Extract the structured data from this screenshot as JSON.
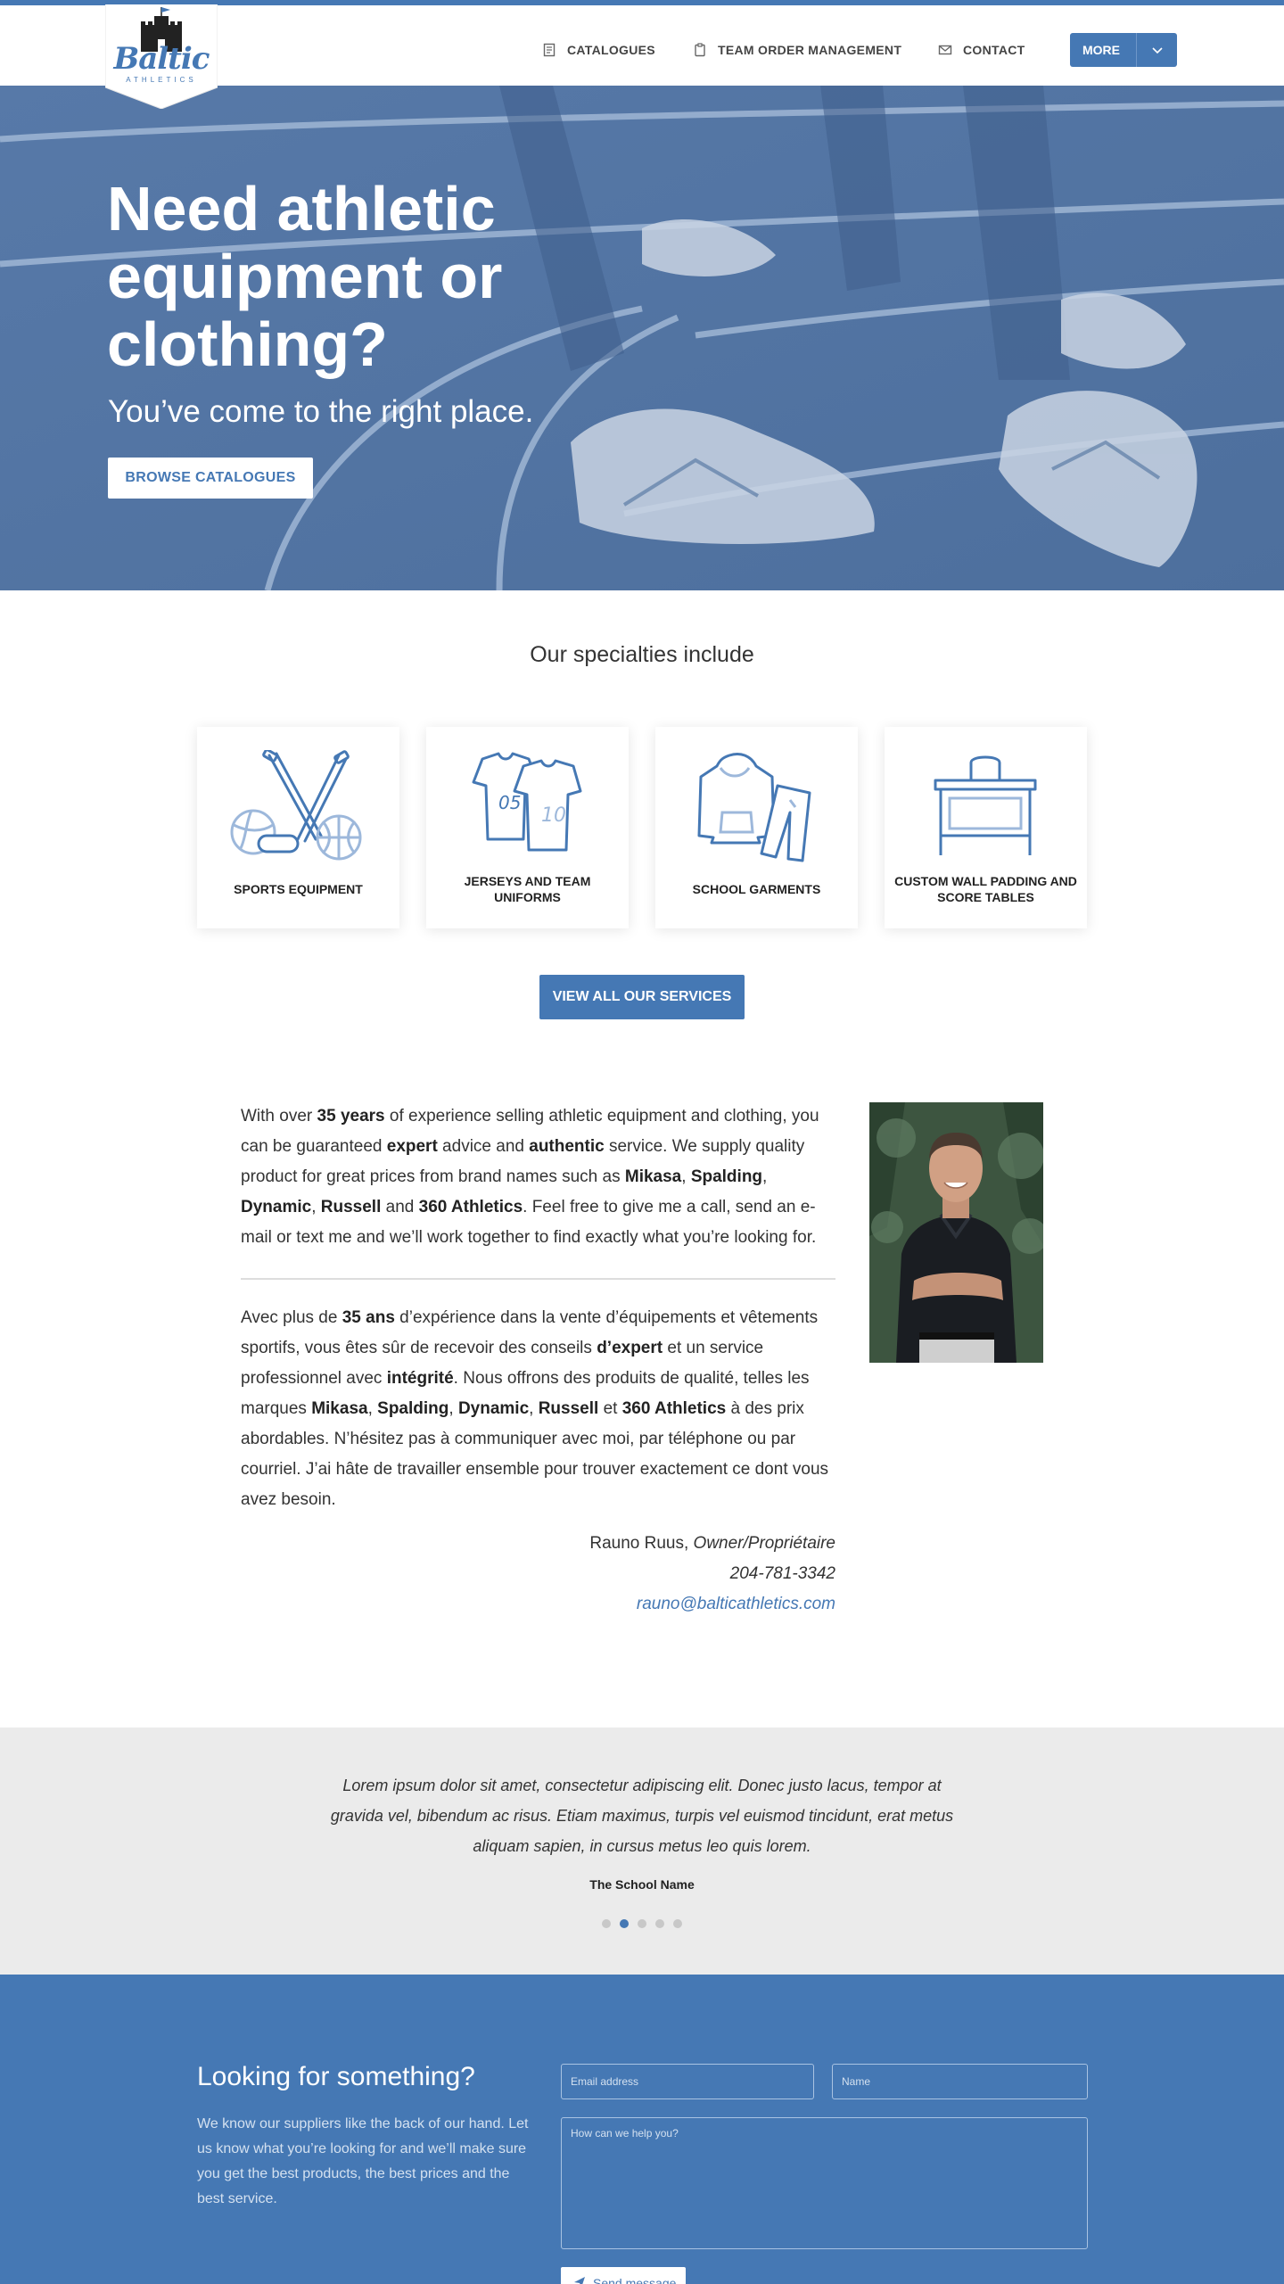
{
  "brand": {
    "logo_word": "Baltic",
    "logo_sub": "ATHLETICS"
  },
  "nav": {
    "catalogues": "CATALOGUES",
    "team_orders": "TEAM ORDER MANAGEMENT",
    "contact": "CONTACT",
    "more": "MORE"
  },
  "hero": {
    "title": "Need athletic equipment or clothing?",
    "subtitle": "You’ve come to the right place.",
    "button": "BROWSE CATALOGUES"
  },
  "specialties": {
    "heading": "Our specialties include",
    "items": [
      {
        "label": "SPORTS EQUIPMENT",
        "icon": "sports-equipment-icon"
      },
      {
        "label": "JERSEYS AND TEAM UNIFORMS",
        "icon": "jersey-icon"
      },
      {
        "label": "SCHOOL GARMENTS",
        "icon": "hoodie-pants-icon"
      },
      {
        "label": "CUSTOM WALL PADDING AND SCORE TABLES",
        "icon": "score-table-icon"
      }
    ],
    "button": "VIEW ALL OUR SERVICES"
  },
  "about": {
    "en": {
      "t1": "With over ",
      "b1": "35 years",
      "t2": " of experience selling athletic equipment and clothing, you can be guaranteed ",
      "b2": "expert",
      "t3": " advice and ",
      "b3": "authentic",
      "t4": " service. We supply quality product for great prices from brand names such as ",
      "b4": "Mikasa",
      "t5": ", ",
      "b5": "Spalding",
      "t6": ", ",
      "b6": "Dynamic",
      "t7": ", ",
      "b7": "Russell",
      "t8": " and ",
      "b8": "360 Athletics",
      "t9": ". Feel free to give me a call, send an e-mail or text me and we’ll work together to find exactly what you’re looking for."
    },
    "fr": {
      "t1": "Avec plus de ",
      "b1": "35 ans",
      "t2": " d’expérience dans la vente d’équipements et vêtements sportifs, vous êtes sûr de recevoir des conseils ",
      "b2": "d’expert",
      "t3": " et un service professionnel avec ",
      "b3": "intégrité",
      "t4": ". Nous offrons des produits de qualité, telles les marques ",
      "b4": "Mikasa",
      "t5": ", ",
      "b5": "Spalding",
      "t6": ", ",
      "b6": "Dynamic",
      "t7": ", ",
      "b7": "Russell",
      "t8": " et ",
      "b8": "360 Athletics",
      "t9": " à des prix abordables. N’hésitez pas à communiquer avec moi, par téléphone ou par courriel. J’ai hâte de travailler ensemble pour trouver exactement ce dont vous avez besoin."
    },
    "signature": {
      "name": "Rauno Ruus, ",
      "role": "Owner/Propriétaire",
      "phone": "204-781-3342",
      "email": "rauno@balticathletics.com"
    }
  },
  "testimonial": {
    "quote": "Lorem ipsum dolor sit amet, consectetur adipiscing elit. Donec justo lacus, tempor at gravida vel, bibendum ac risus. Etiam maximus, turpis vel euismod tincidunt, erat metus aliquam sapien, in cursus metus leo quis lorem.",
    "author": "The School Name",
    "slide_count": 5,
    "active_slide": 2
  },
  "contact_form": {
    "title": "Looking for something?",
    "text": "We know our suppliers like the back of our hand. Let us know what you’re looking for and we’ll make sure you get the best products, the best prices and the best service.",
    "email_placeholder": "Email address",
    "name_placeholder": "Name",
    "message_placeholder": "How can we help you?",
    "send_label": "Send message"
  },
  "colors": {
    "accent": "#4578b4",
    "testimonial_bg": "#ebebeb",
    "text": "#333333"
  }
}
